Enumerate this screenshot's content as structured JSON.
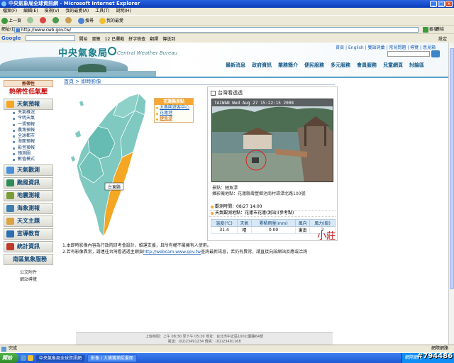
{
  "window": {
    "title": "中央氣象局全球資訊網 - Microsoft Internet Explorer"
  },
  "menu": [
    "檔案(F)",
    "編輯(E)",
    "檢視(V)",
    "我的最愛(A)",
    "工具(T)",
    "說明(H)"
  ],
  "toolbar": {
    "back": "上一頁",
    "search": "搜尋",
    "favorites": "我的最愛"
  },
  "address": {
    "label": "網址(D)",
    "url": "http://www.cwb.gov.tw/",
    "go": "移至",
    "links": "連結"
  },
  "google": {
    "logo": "Google",
    "items": [
      "開始",
      "書籤",
      "12 已攔截",
      "拼字檢查",
      "翻譯",
      "傳送到"
    ],
    "settings": "設定"
  },
  "site": {
    "logo_cn": "中央氣象局",
    "logo_en": "Central Weather Bureau",
    "toplinks": "首頁 | English | 雙語詞彙 | 常見問題 | 導覽 | 意見箱",
    "nav": [
      "最新消息",
      "政府資訊",
      "業務簡介",
      "便民服務",
      "多元服務",
      "會員服務",
      "兒童網頁",
      "討論區"
    ]
  },
  "sidebar": {
    "highlight1": "熱帶性",
    "highlight2": "熱帶性低氣壓",
    "categories": [
      {
        "label": "天氣預報",
        "color": "#f5a623"
      },
      {
        "label": "天氣觀測",
        "color": "#4a90d9"
      },
      {
        "label": "颱風資訊",
        "color": "#2e8b57"
      },
      {
        "label": "地震測報",
        "color": "#7b9c35"
      },
      {
        "label": "海象測報",
        "color": "#3c7fb0"
      },
      {
        "label": "天文主題",
        "color": "#d9a441"
      },
      {
        "label": "宣導教育",
        "color": "#2b6fb0"
      },
      {
        "label": "統計資訊",
        "color": "#c0392b"
      },
      {
        "label": "南區氣象服務",
        "color": "#888888"
      }
    ],
    "forecast_items": [
      "天氣概況",
      "今明天氣",
      "一週預報",
      "農漁預報",
      "全球都市",
      "海面預報",
      "影音預報",
      "預測圖",
      "數值模式"
    ],
    "bottom": [
      "公文附件",
      "網站導覽"
    ]
  },
  "breadcrumb": "首頁 > 即時影像",
  "legend": {
    "header": "花蓮縣景點",
    "items": [
      "太魯閣遊客中心",
      "花蓮港",
      "鯉魚潭"
    ],
    "current": 2
  },
  "map": {
    "selected_label": "台東縣"
  },
  "camera": {
    "header": "台灣看透透",
    "overlay": "TAIWAN   Wed Aug 27  15:22:15  2008",
    "place_label": "景點：鯉魚潭",
    "address_label": "攝影機地點：花蓮縣壽豐鄉池南村環潭北路100號",
    "time_label": "觀測時間：08/27 14:00",
    "station_label": "天氣觀測地點：花蓮市花蓮(測站)(參考點)"
  },
  "weather": {
    "headers": [
      "溫度(℃)",
      "天氣",
      "累積雨量(mm)",
      "風向",
      "風力(級)"
    ],
    "row": [
      "31.4",
      "晴",
      "0.00",
      "東南",
      "2"
    ]
  },
  "notes": [
    "1.本即時影像內容為行政院研考會設計，維運支援，且所有權不屬擁有人使用。",
    "2.若有影像異常，請連往台灣看透透主網頁",
    "查詢最新訊息，若仍有異常，請直接向該網站反應或洽詢",
    "http://webcam.www.gov.tw"
  ],
  "annotation": "小莊",
  "footer": {
    "line1": "上班時間：上午 08:30 至下午 05:30 地址：台北市中正區100公園路64號",
    "line2": "電話：(02)23491234 傳真：(02)23491168"
  },
  "status": {
    "text": "完成",
    "zone": "網際網路"
  },
  "taskbar": {
    "start": "開始",
    "tasks": [
      "中央氣象局全球資訊網",
      "影像 / 大捕獲捕捉畫面"
    ],
    "tray": "網際網路"
  },
  "watermark": "#794486"
}
